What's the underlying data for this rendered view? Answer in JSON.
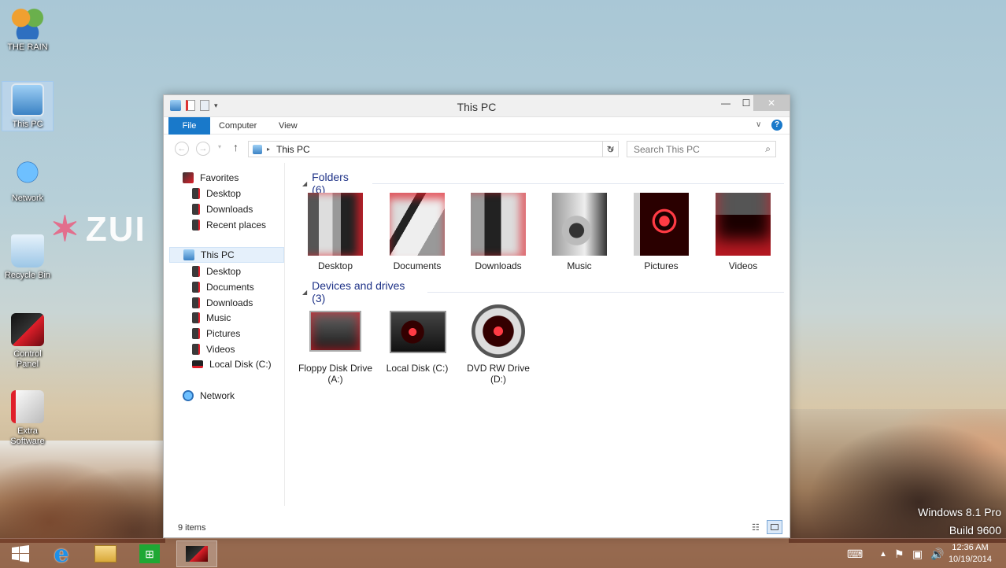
{
  "desktop": {
    "icons": [
      {
        "label": "THE RAIN",
        "icon": "users-icon"
      },
      {
        "label": "This PC",
        "icon": "computer-icon"
      },
      {
        "label": "Network",
        "icon": "network-icon"
      },
      {
        "label": "Recycle Bin",
        "icon": "recycle-bin-icon"
      },
      {
        "label": "Control Panel",
        "icon": "control-panel-icon"
      },
      {
        "label": "Extra Software",
        "icon": "software-icon"
      }
    ],
    "zune_text": "ZUI",
    "watermark": {
      "line1": "Windows 8.1 Pro",
      "line2": "Build 9600"
    }
  },
  "window": {
    "title": "This PC",
    "tabs": {
      "file": "File",
      "computer": "Computer",
      "view": "View"
    },
    "address": "This PC",
    "search_placeholder": "Search This PC",
    "nav": {
      "favorites": "Favorites",
      "favorites_items": [
        "Desktop",
        "Downloads",
        "Recent places"
      ],
      "this_pc": "This PC",
      "this_pc_items": [
        "Desktop",
        "Documents",
        "Downloads",
        "Music",
        "Pictures",
        "Videos",
        "Local Disk (C:)"
      ],
      "network": "Network"
    },
    "groups": {
      "folders": "Folders (6)",
      "devices": "Devices and drives (3)"
    },
    "folders": [
      "Desktop",
      "Documents",
      "Downloads",
      "Music",
      "Pictures",
      "Videos"
    ],
    "drives": [
      {
        "line1": "Floppy Disk Drive",
        "line2": "(A:)"
      },
      {
        "line1": "Local Disk (C:)",
        "line2": ""
      },
      {
        "line1": "DVD RW Drive",
        "line2": "(D:)"
      }
    ],
    "status": "9 items"
  },
  "taskbar": {
    "clock_time": "12:36 AM",
    "clock_date": "10/19/2014"
  },
  "colors": {
    "accent": "#1979ca",
    "group_header": "#1e3287",
    "theme_red": "#e01f2a"
  }
}
